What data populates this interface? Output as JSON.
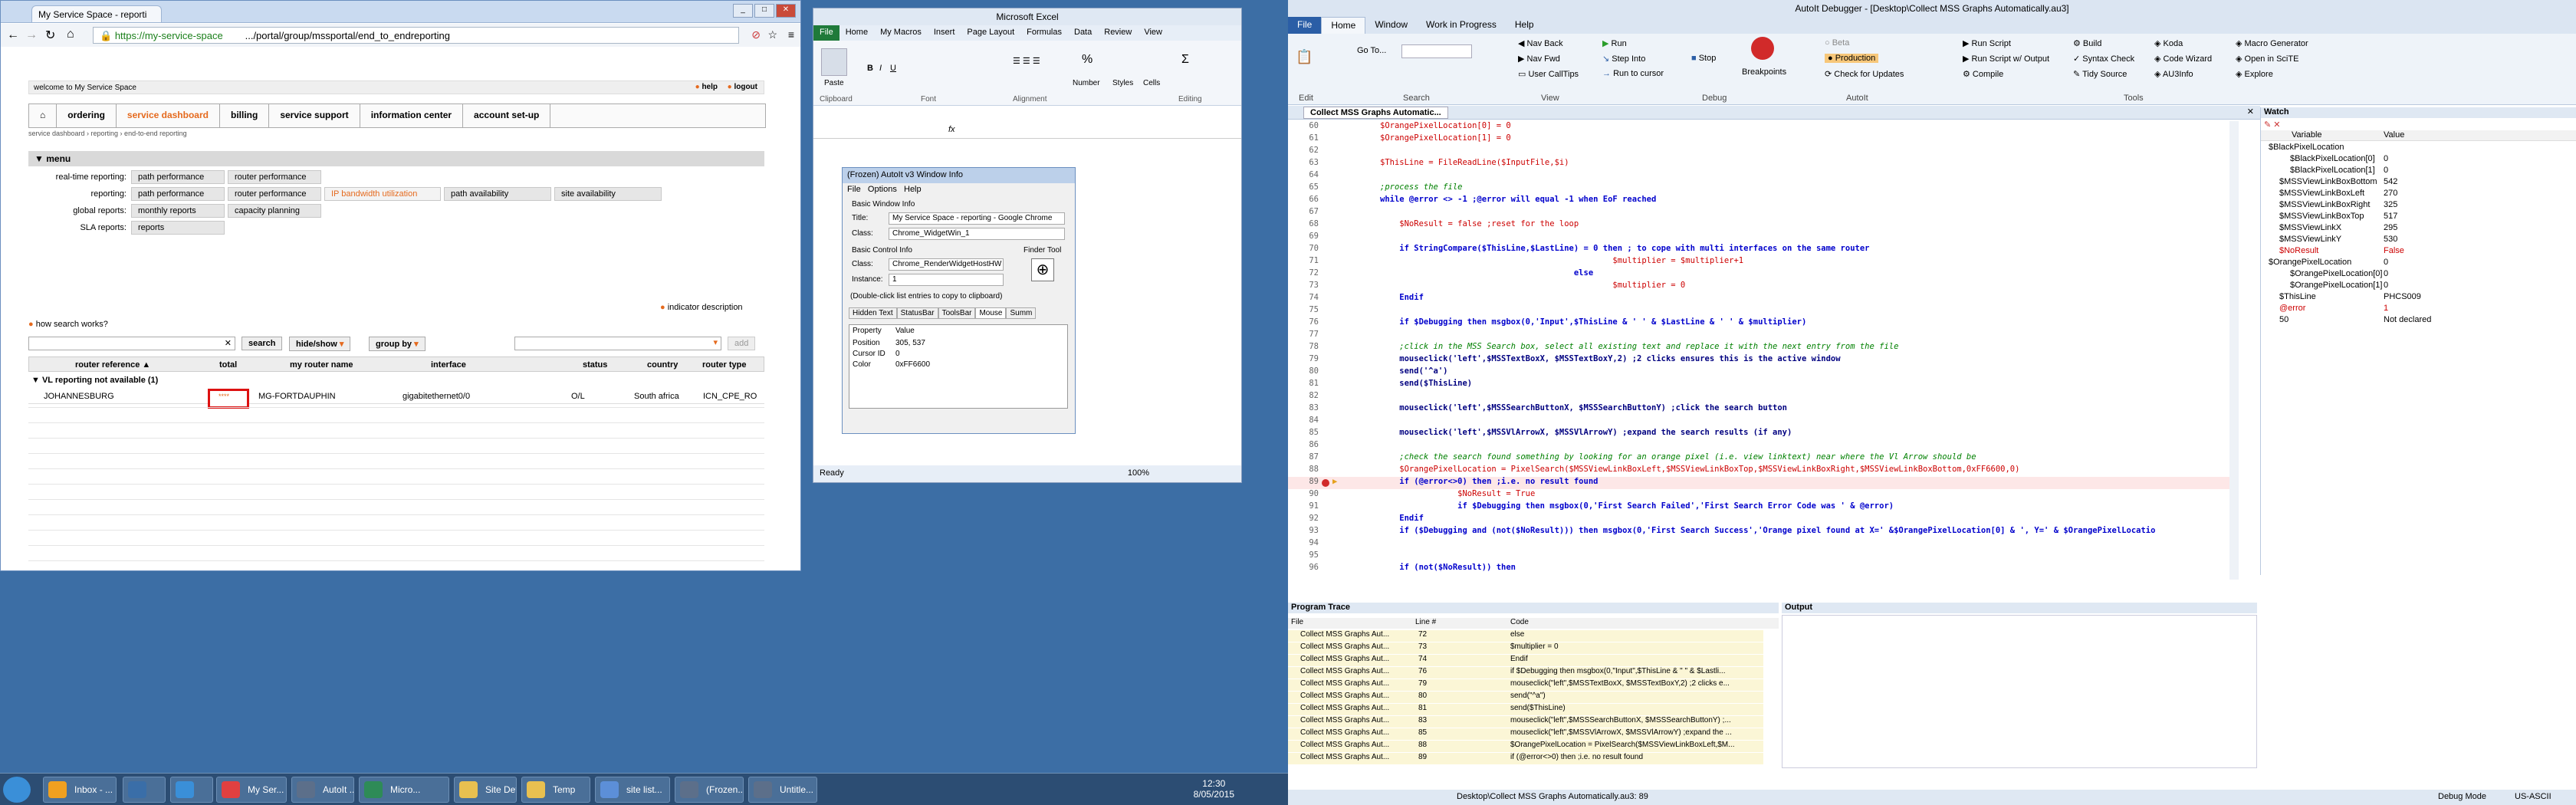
{
  "chrome": {
    "tab_title": "My Service Space - reporti",
    "url_https": "https://my-service-space",
    "url_path": ".../portal/group/mssportal/end_to_endreporting",
    "welcome": "welcome to My Service Space",
    "help": "help",
    "logout": "logout",
    "nav": [
      "ordering",
      "service dashboard",
      "billing",
      "service support",
      "information center",
      "account set-up"
    ],
    "breadcrumb": "service dashboard › reporting › end-to-end reporting",
    "menu_title": "menu",
    "menu_rows": [
      {
        "label": "real-time reporting:",
        "items": [
          "path performance",
          "router performance"
        ]
      },
      {
        "label": "reporting:",
        "items": [
          "path performance",
          "router performance",
          "IP bandwidth utilization",
          "path availability",
          "site availability"
        ]
      },
      {
        "label": "global reports:",
        "items": [
          "monthly reports",
          "capacity planning"
        ]
      },
      {
        "label": "SLA reports:",
        "items": [
          "reports"
        ]
      }
    ],
    "indicator": "indicator description",
    "how_search": "how search works?",
    "search_btn": "search",
    "hide_show": "hide/show",
    "group_by": "group by",
    "add_btn": "add",
    "columns": [
      "router reference",
      "total",
      "my router name",
      "interface",
      "status",
      "country",
      "router type"
    ],
    "group_row": "VL reporting not available (1)",
    "rows": [
      {
        "ref": "JOHANNESBURG",
        "total": "****",
        "name": "MG-FORTDAUPHIN",
        "interface": "gigabitethernet0/0",
        "status": "O/L",
        "country": "South africa",
        "type": "ICN_CPE_RO"
      }
    ]
  },
  "excel": {
    "title": "Microsoft Excel",
    "tabs": [
      "File",
      "Home",
      "My Macros",
      "Insert",
      "Page Layout",
      "Formulas",
      "Data",
      "Review",
      "View"
    ],
    "groups": [
      "Clipboard",
      "Font",
      "Alignment",
      "Number",
      "Styles",
      "Cells",
      "Editing"
    ],
    "paste": "Paste",
    "number": "Number",
    "styles": "Styles",
    "cells": "Cells",
    "status": "Ready",
    "zoom": "100%"
  },
  "winfo": {
    "title": "(Frozen) AutoIt v3 Window Info",
    "menu": [
      "File",
      "Options",
      "Help"
    ],
    "basic_window": "Basic Window Info",
    "title_label": "Title:",
    "title_value": "My Service Space - reporting - Google Chrome",
    "class_label": "Class:",
    "class_value": "Chrome_WidgetWin_1",
    "basic_control": "Basic Control Info",
    "finder_tool": "Finder Tool",
    "ctrl_class_value": "Chrome_RenderWidgetHostHW",
    "instance_label": "Instance:",
    "instance_value": "1",
    "hint": "(Double-click list entries to copy to clipboard)",
    "tabs": [
      "Hidden Text",
      "StatusBar",
      "ToolsBar",
      "Mouse",
      "Summ"
    ],
    "prop_header": [
      "Property",
      "Value"
    ],
    "props": [
      {
        "k": "Position",
        "v": "305, 537"
      },
      {
        "k": "Cursor ID",
        "v": "0"
      },
      {
        "k": "Color",
        "v": "0xFF6600"
      }
    ]
  },
  "debugger": {
    "title": "AutoIt Debugger - [Desktop\\Collect MSS Graphs Automatically.au3]",
    "tabs": [
      "File",
      "Home",
      "Window",
      "Work in Progress",
      "Help"
    ],
    "ribbon": {
      "edit": "Edit",
      "goto": "Go To...",
      "search": "Search",
      "nav_back": "Nav Back",
      "nav_fwd": "Nav Fwd",
      "user_calltips": "User CallTips",
      "view": "View",
      "run": "Run",
      "step_into": "Step Into",
      "run_to_cursor": "Run to cursor",
      "stop": "Stop",
      "breakpoints": "Breakpoints",
      "debug": "Debug",
      "beta": "Beta",
      "production": "Production",
      "check_updates": "Check for Updates",
      "autoit": "AutoIt",
      "run_script": "Run Script",
      "run_script_output": "Run Script w/ Output",
      "compile": "Compile",
      "build": "Build",
      "syntax_check": "Syntax Check",
      "tidy_source": "Tidy Source",
      "koda": "Koda",
      "code_wizard": "Code Wizard",
      "au3info": "AU3Info",
      "macro_gen": "Macro Generator",
      "open_scite": "Open in SciTE",
      "explore": "Explore",
      "tools": "Tools"
    },
    "doc_tab": "Collect MSS Graphs Automatic...",
    "code": [
      {
        "n": "60",
        "t": "$OrangePixelLocation[0] = 0"
      },
      {
        "n": "61",
        "t": "$OrangePixelLocation[1] = 0"
      },
      {
        "n": "62",
        "t": ""
      },
      {
        "n": "63",
        "t": "$ThisLine = FileReadLine($InputFile,$i)"
      },
      {
        "n": "64",
        "t": ""
      },
      {
        "n": "65",
        "t": ";process the file"
      },
      {
        "n": "66",
        "t": "while @error <> -1 ;@error will equal -1 when EoF reached"
      },
      {
        "n": "67",
        "t": ""
      },
      {
        "n": "68",
        "t": "    $NoResult = false ;reset for the loop"
      },
      {
        "n": "69",
        "t": ""
      },
      {
        "n": "70",
        "t": "    if StringCompare($ThisLine,$LastLine) = 0 then ; to cope with multi interfaces on the same router"
      },
      {
        "n": "71",
        "t": "                                                $multiplier = $multiplier+1"
      },
      {
        "n": "72",
        "t": "                                        else"
      },
      {
        "n": "73",
        "t": "                                                $multiplier = 0"
      },
      {
        "n": "74",
        "t": "    Endif"
      },
      {
        "n": "75",
        "t": ""
      },
      {
        "n": "76",
        "t": "    if $Debugging then msgbox(0,'Input',$ThisLine & ' ' & $LastLine & ' ' & $multiplier)"
      },
      {
        "n": "77",
        "t": ""
      },
      {
        "n": "78",
        "t": "    ;click in the MSS Search box, select all existing text and replace it with the next entry from the file"
      },
      {
        "n": "79",
        "t": "    mouseclick('left',$MSSTextBoxX, $MSSTextBoxY,2) ;2 clicks ensures this is the active window"
      },
      {
        "n": "80",
        "t": "    send('^a')"
      },
      {
        "n": "81",
        "t": "    send($ThisLine)"
      },
      {
        "n": "82",
        "t": ""
      },
      {
        "n": "83",
        "t": "    mouseclick('left',$MSSSearchButtonX, $MSSSearchButtonY) ;click the search button"
      },
      {
        "n": "84",
        "t": ""
      },
      {
        "n": "85",
        "t": "    mouseclick('left',$MSSVlArrowX, $MSSVlArrowY) ;expand the search results (if any)"
      },
      {
        "n": "86",
        "t": ""
      },
      {
        "n": "87",
        "t": "    ;check the search found something by looking for an orange pixel (i.e. view linktext) near where the Vl Arrow should be"
      },
      {
        "n": "88",
        "t": "    $OrangePixelLocation = PixelSearch($MSSViewLinkBoxLeft,$MSSViewLinkBoxTop,$MSSViewLinkBoxRight,$MSSViewLinkBoxBottom,0xFF6600,0)"
      },
      {
        "n": "89",
        "t": "    if (@error<>0) then ;i.e. no result found"
      },
      {
        "n": "90",
        "t": "                $NoResult = True"
      },
      {
        "n": "91",
        "t": "                if $Debugging then msgbox(0,'First Search Failed','First Search Error Code was ' & @error)"
      },
      {
        "n": "92",
        "t": "    Endif"
      },
      {
        "n": "93",
        "t": "    if ($Debugging and (not($NoResult))) then msgbox(0,'First Search Success','Orange pixel found at X=' &$OrangePixelLocation[0] & ', Y=' & $OrangePixelLocatio"
      },
      {
        "n": "94",
        "t": ""
      },
      {
        "n": "95",
        "t": ""
      },
      {
        "n": "96",
        "t": "    if (not($NoResult)) then"
      }
    ],
    "watch_title": "Watch",
    "watch_cols": [
      "Variable",
      "Value"
    ],
    "watch": [
      {
        "v": "$BlackPixelLocation",
        "val": "",
        "d": 0,
        "red": false
      },
      {
        "v": "$BlackPixelLocation[0]",
        "val": "0",
        "d": 2,
        "red": false
      },
      {
        "v": "$BlackPixelLocation[1]",
        "val": "0",
        "d": 2,
        "red": false
      },
      {
        "v": "$MSSViewLinkBoxBottom",
        "val": "542",
        "d": 1,
        "red": false
      },
      {
        "v": "$MSSViewLinkBoxLeft",
        "val": "270",
        "d": 1,
        "red": false
      },
      {
        "v": "$MSSViewLinkBoxRight",
        "val": "325",
        "d": 1,
        "red": false
      },
      {
        "v": "$MSSViewLinkBoxTop",
        "val": "517",
        "d": 1,
        "red": false
      },
      {
        "v": "$MSSViewLinkX",
        "val": "295",
        "d": 1,
        "red": false
      },
      {
        "v": "$MSSViewLinkY",
        "val": "530",
        "d": 1,
        "red": false
      },
      {
        "v": "$NoResult",
        "val": "False",
        "d": 1,
        "red": true
      },
      {
        "v": "$OrangePixelLocation",
        "val": "0",
        "d": 0,
        "red": false
      },
      {
        "v": "$OrangePixelLocation[0]",
        "val": "0",
        "d": 2,
        "red": false
      },
      {
        "v": "$OrangePixelLocation[1]",
        "val": "0",
        "d": 2,
        "red": false
      },
      {
        "v": "$ThisLine",
        "val": "PHCS009",
        "d": 1,
        "red": false
      },
      {
        "v": "@error",
        "val": "1",
        "d": 1,
        "red": true
      },
      {
        "v": "50",
        "val": "Not declared",
        "d": 1,
        "red": false
      }
    ],
    "trace_title": "Program Trace",
    "trace_cols": [
      "File",
      "Line #",
      "Code"
    ],
    "trace": [
      {
        "f": "Collect MSS Graphs Aut...",
        "l": "72",
        "c": "else"
      },
      {
        "f": "Collect MSS Graphs Aut...",
        "l": "73",
        "c": "$multiplier = 0"
      },
      {
        "f": "Collect MSS Graphs Aut...",
        "l": "74",
        "c": "Endif"
      },
      {
        "f": "Collect MSS Graphs Aut...",
        "l": "76",
        "c": "if $Debugging then msgbox(0,\"Input\",$ThisLine & \" \" & $Lastli..."
      },
      {
        "f": "Collect MSS Graphs Aut...",
        "l": "79",
        "c": "mouseclick(\"left\",$MSSTextBoxX, $MSSTextBoxY,2) ;2 clicks e..."
      },
      {
        "f": "Collect MSS Graphs Aut...",
        "l": "80",
        "c": "send(\"^a\")"
      },
      {
        "f": "Collect MSS Graphs Aut...",
        "l": "81",
        "c": "send($ThisLine)"
      },
      {
        "f": "Collect MSS Graphs Aut...",
        "l": "83",
        "c": "mouseclick(\"left\",$MSSSearchButtonX, $MSSSearchButtonY) ;..."
      },
      {
        "f": "Collect MSS Graphs Aut...",
        "l": "85",
        "c": "mouseclick(\"left\",$MSSVlArrowX, $MSSVlArrowY) ;expand the ..."
      },
      {
        "f": "Collect MSS Graphs Aut...",
        "l": "88",
        "c": "$OrangePixelLocation = PixelSearch($MSSViewLinkBoxLeft,$M..."
      },
      {
        "f": "Collect MSS Graphs Aut...",
        "l": "89",
        "c": "if (@error<>0) then ;i.e. no result found"
      }
    ],
    "output_title": "Output",
    "status_path": "Desktop\\Collect MSS Graphs Automatically.au3: 89",
    "status_mode": "Debug Mode",
    "status_enc": "US-ASCII"
  },
  "taskbar": {
    "items": [
      "Inbox - ...",
      "",
      "",
      "My Ser...",
      "AutoIt ...",
      "Micro...",
      "Site Det...",
      "Temp",
      "site list...",
      "(Frozen...",
      "Untitle..."
    ],
    "time": "12:30",
    "date": "8/05/2015"
  }
}
